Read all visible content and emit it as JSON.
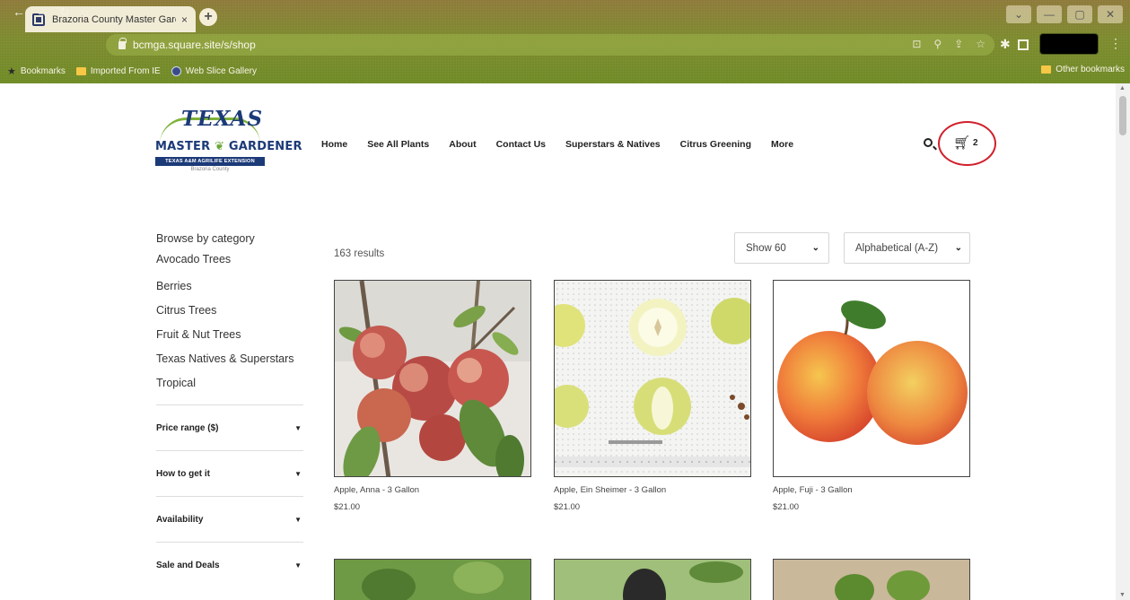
{
  "browser": {
    "tab_title": "Brazoria County Master Gardene",
    "tab_close": "×",
    "new_tab": "+",
    "url": "bcmga.square.site/s/shop",
    "bookmarks": [
      {
        "label": "Bookmarks",
        "icon": "star-icon"
      },
      {
        "label": "Imported From IE",
        "icon": "folder-icon"
      },
      {
        "label": "Web Slice Gallery",
        "icon": "globe-icon"
      }
    ],
    "other_bookmarks": "Other bookmarks",
    "window_controls": [
      "⌄",
      "—",
      "▢",
      "✕"
    ]
  },
  "site": {
    "logo": {
      "line1": "TEXAS",
      "line2a": "MASTER",
      "line2b": "GARDENER",
      "line3": "TEXAS A&M AGRILIFE EXTENSION",
      "line4": "Brazoria County"
    },
    "nav": [
      "Home",
      "See All Plants",
      "About",
      "Contact Us",
      "Superstars & Natives",
      "Citrus Greening",
      "More"
    ],
    "cart_count": "2"
  },
  "sidebar": {
    "heading": "Browse by category",
    "categories": [
      "Avocado Trees",
      "Berries",
      "Citrus Trees",
      "Fruit & Nut Trees",
      "Texas Natives & Superstars",
      "Tropical"
    ],
    "filters": [
      "Price range ($)",
      "How to get it",
      "Availability",
      "Sale and Deals"
    ]
  },
  "listing": {
    "results": "163 results",
    "show": "Show 60",
    "sort": "Alphabetical (A-Z)"
  },
  "products": [
    {
      "name": "Apple, Anna - 3 Gallon",
      "price": "$21.00"
    },
    {
      "name": "Apple, Ein Sheimer - 3 Gallon",
      "price": "$21.00"
    },
    {
      "name": "Apple, Fuji - 3 Gallon",
      "price": "$21.00"
    }
  ],
  "colors": {
    "accent_circle": "#d0202b",
    "logo_blue": "#1c3a78",
    "logo_green": "#7fb239"
  }
}
